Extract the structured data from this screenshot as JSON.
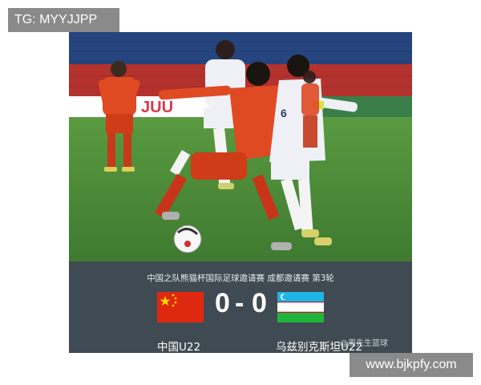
{
  "badges": {
    "top_left": "TG: MYYJJPP",
    "bottom_right": "www.bjkpfy.com"
  },
  "scoreboard": {
    "title": "中国之队熊猫杯国际足球邀请赛 成都邀请赛 第3轮",
    "home_score": "0",
    "separator": "-",
    "away_score": "0",
    "home_team": "中国U22",
    "away_team": "乌兹别克斯坦U22",
    "watermark": "@周先生篮球"
  },
  "photo": {
    "banner_text": "JUU",
    "jersey_number": "6",
    "colors": {
      "home_kit": "#e04a23",
      "away_kit": "#eef0f6",
      "pitch": "#4c8a3a",
      "stands": "#2a4a8a"
    }
  }
}
